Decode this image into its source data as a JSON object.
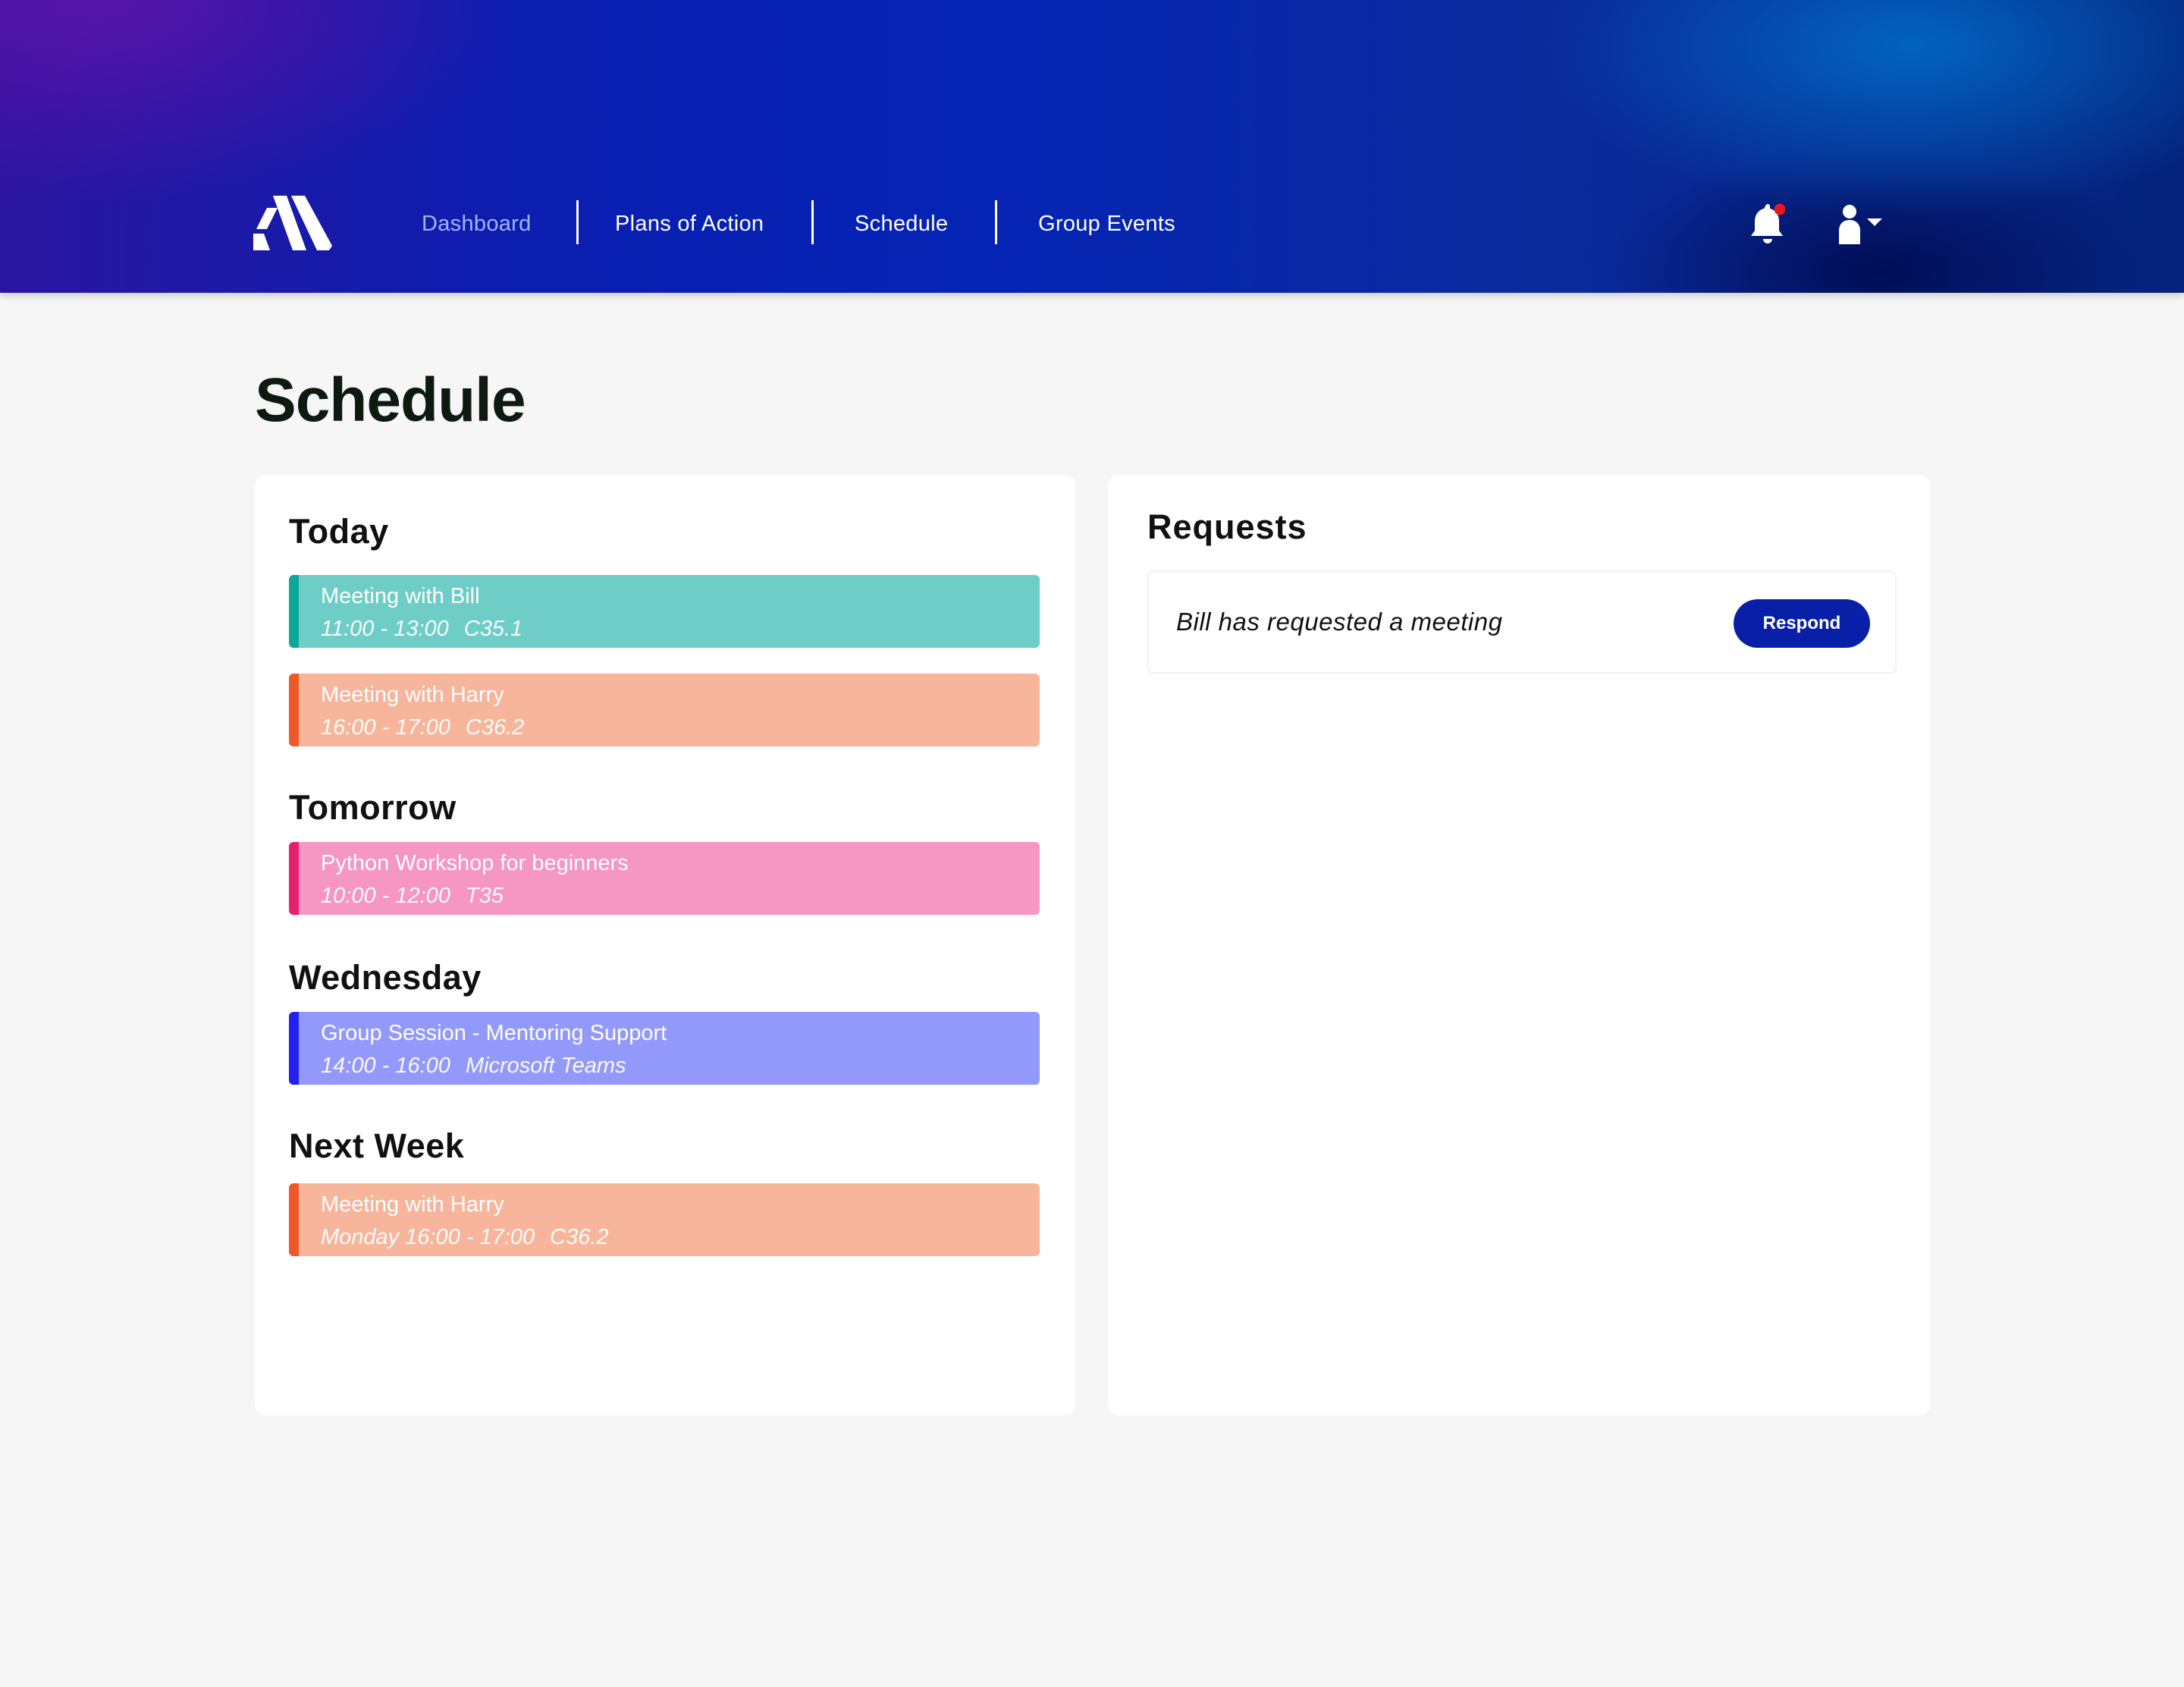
{
  "nav": {
    "logo": "app-logo",
    "items": [
      {
        "label": "Dashboard",
        "active": false
      },
      {
        "label": "Plans of Action"
      },
      {
        "label": "Schedule"
      },
      {
        "label": "Group Events"
      }
    ],
    "icons": {
      "notifications": "bell-icon",
      "account": "user-icon",
      "dropdown": "caret-down-icon"
    },
    "notification_dot_color": "#e8191d"
  },
  "page": {
    "title": "Schedule"
  },
  "schedule": {
    "groups": [
      {
        "heading": "Today",
        "events": [
          {
            "title": "Meeting with Bill",
            "time": "11:00 - 13:00",
            "place": "C35.1",
            "color": "#6ecdc6",
            "accent": "#0ea898"
          },
          {
            "title": "Meeting with Harry",
            "time": "16:00 - 17:00",
            "place": "C36.2",
            "color": "#f7b59c",
            "accent": "#f0572a"
          }
        ]
      },
      {
        "heading": "Tomorrow",
        "events": [
          {
            "title": "Python Workshop for beginners",
            "time": "10:00 - 12:00",
            "place": "T35",
            "color": "#f696c2",
            "accent": "#e81f6d"
          }
        ]
      },
      {
        "heading": "Wednesday",
        "events": [
          {
            "title": "Group Session - Mentoring Support",
            "time": "14:00 - 16:00",
            "place": "Microsoft Teams",
            "color": "#9399fb",
            "accent": "#2420f2"
          }
        ]
      },
      {
        "heading": "Next Week",
        "events": [
          {
            "title": "Meeting with Harry",
            "time": "Monday 16:00 - 17:00",
            "place": "C36.2",
            "color": "#f7b59c",
            "accent": "#f0572a"
          }
        ]
      }
    ]
  },
  "requests": {
    "title": "Requests",
    "items": [
      {
        "text": "Bill has requested a meeting",
        "action": "Respond"
      }
    ]
  }
}
